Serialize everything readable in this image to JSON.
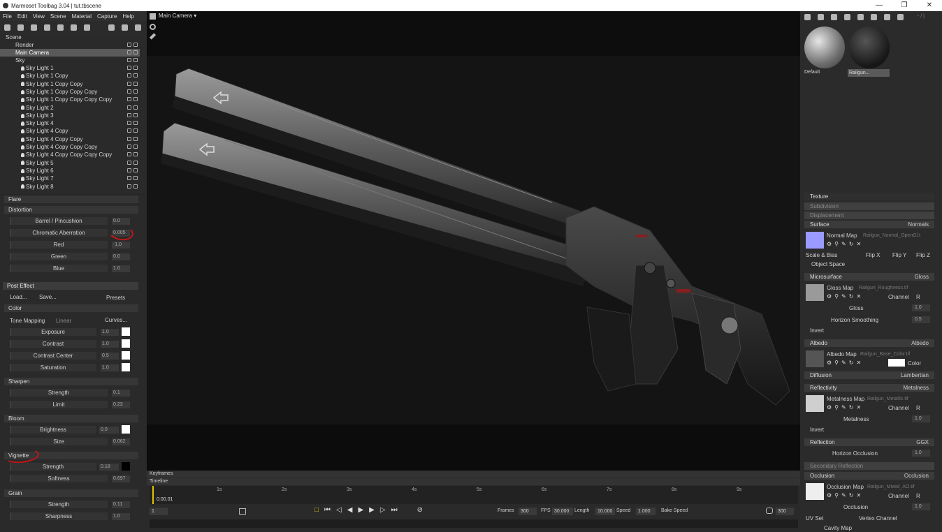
{
  "window": {
    "title": "Marmoset Toolbag 3.04 | tut.tbscene",
    "minimize": "—",
    "maximize": "❐",
    "close": "✕"
  },
  "menu": [
    "File",
    "Edit",
    "View",
    "Scene",
    "Material",
    "Capture",
    "Help"
  ],
  "scene_tree": {
    "items": [
      "Scene",
      "Render",
      "Main Camera",
      "Sky",
      "Sky Light 1",
      "Sky Light 1 Copy",
      "Sky Light 1 Copy Copy",
      "Sky Light 1 Copy Copy Copy",
      "Sky Light 1 Copy Copy Copy Copy",
      "Sky Light 2",
      "Sky Light 3",
      "Sky Light 4",
      "Sky Light 4 Copy",
      "Sky Light 4 Copy Copy",
      "Sky Light 4 Copy Copy Copy",
      "Sky Light 4 Copy Copy Copy Copy",
      "Sky Light 5",
      "Sky Light 6",
      "Sky Light 7",
      "Sky Light 8"
    ],
    "selected": "Main Camera"
  },
  "camera_panel": {
    "flare": "Flare",
    "distortion": {
      "title": "Distortion",
      "barrel_label": "Barrel / Pincushion",
      "barrel_value": "0.0",
      "chromatic_label": "Chromatic Aberration",
      "chromatic_value": "0.005",
      "red_label": "Red",
      "red_value": "-1.0",
      "green_label": "Green",
      "green_value": "0.0",
      "blue_label": "Blue",
      "blue_value": "1.0"
    },
    "post_effect": {
      "title": "Post Effect",
      "load": "Load...",
      "save": "Save...",
      "presets": "Presets",
      "color_title": "Color",
      "tone_mapping_label": "Tone Mapping",
      "tone_mapping_value": "Linear",
      "curves": "Curves...",
      "exposure_label": "Exposure",
      "exposure_value": "1.0",
      "contrast_label": "Contrast",
      "contrast_value": "1.0",
      "contrast_center_label": "Contrast Center",
      "contrast_center_value": "0.5",
      "saturation_label": "Saturation",
      "saturation_value": "1.0"
    },
    "sharpen": {
      "title": "Sharpen",
      "strength_label": "Strength",
      "strength_value": "0.1",
      "limit_label": "Limit",
      "limit_value": "0.23"
    },
    "bloom": {
      "title": "Bloom",
      "brightness_label": "Brightness",
      "brightness_value": "0.0",
      "size_label": "Size",
      "size_value": "0.062"
    },
    "vignette": {
      "title": "Vignette",
      "strength_label": "Strength",
      "strength_value": "0.18",
      "softness_label": "Softness",
      "softness_value": "0.697"
    },
    "grain": {
      "title": "Grain",
      "strength_label": "Strength",
      "strength_value": "0.11",
      "sharpness_label": "Sharpness",
      "sharpness_value": "1.0"
    }
  },
  "viewport": {
    "camera_label": "Main Camera ▾"
  },
  "timeline": {
    "keyframes": "Keyframes",
    "timeline": "Timeline",
    "current_time": "0:00.01",
    "ticks": [
      "1s",
      "2s",
      "3s",
      "4s",
      "5s",
      "6s",
      "7s",
      "8s",
      "9s"
    ],
    "frame_field": "1",
    "frames_label": "Frames",
    "frames_value": "300",
    "fps_label": "FPS",
    "fps_value": "30.000",
    "length_label": "Length",
    "length_value": "10.000",
    "speed_label": "Speed",
    "speed_value": "1.000",
    "bake_speed": "Bake Speed",
    "end_value": "300"
  },
  "materials": {
    "items": [
      {
        "name": "Default"
      },
      {
        "name": "Railgun..."
      }
    ],
    "selected": "Railgun...",
    "path_hint": "- / |"
  },
  "material_props": {
    "texture": "Texture",
    "subdivision": "Subdivision",
    "displacement": "Displacement",
    "surface": {
      "title": "Surface",
      "mode": "Normals",
      "map_label": "Normal Map",
      "map_file": "Railgun_Normal_OpenGl.t",
      "scale_bias": "Scale & Bias",
      "flip_x": "Flip X",
      "flip_y": "Flip Y",
      "flip_z": "Flip Z",
      "object_space": "Object Space"
    },
    "microsurface": {
      "title": "Microsurface",
      "mode": "Gloss",
      "map_label": "Gloss Map",
      "map_file": "Railgun_Roughness.tif",
      "channel_label": "Channel",
      "channel_value": "R",
      "gloss_label": "Gloss",
      "gloss_value": "1.0",
      "horizon_label": "Horizon Smoothing",
      "horizon_value": "0.5",
      "invert": "Invert"
    },
    "albedo": {
      "title": "Albedo",
      "mode": "Albedo",
      "map_label": "Albedo Map",
      "map_file": "Railgun_Base_Color.tif",
      "color_label": "Color"
    },
    "diffusion": {
      "title": "Diffusion",
      "mode": "Lambertian"
    },
    "reflectivity": {
      "title": "Reflectivity",
      "mode": "Metalness",
      "map_label": "Metalness Map",
      "map_file": "Railgun_Metallic.tif",
      "channel_label": "Channel",
      "channel_value": "R",
      "metalness_label": "Metalness",
      "metalness_value": "1.0",
      "invert": "Invert"
    },
    "reflection": {
      "title": "Reflection",
      "mode": "GGX",
      "horizon_label": "Horizon Occlusion",
      "horizon_value": "1.0"
    },
    "secondary_reflection": "Secondary Reflection",
    "occlusion": {
      "title": "Occlusion",
      "mode": "Occlusion",
      "map_label": "Occlusion Map",
      "map_file": "Railgun_Mixed_AO.tif",
      "channel_label": "Channel",
      "channel_value": "R",
      "occlusion_label": "Occlusion",
      "occlusion_value": "1.0",
      "uv_set": "UV Set",
      "vertex_channel": "Vertex Channel",
      "cavity": "Cavity Map"
    }
  },
  "colors": {
    "annotation_red": "#c31616",
    "normal_swatch": "#9a9aff",
    "panel_bg": "#2a2a2a",
    "viewport_bg": "#141414"
  }
}
